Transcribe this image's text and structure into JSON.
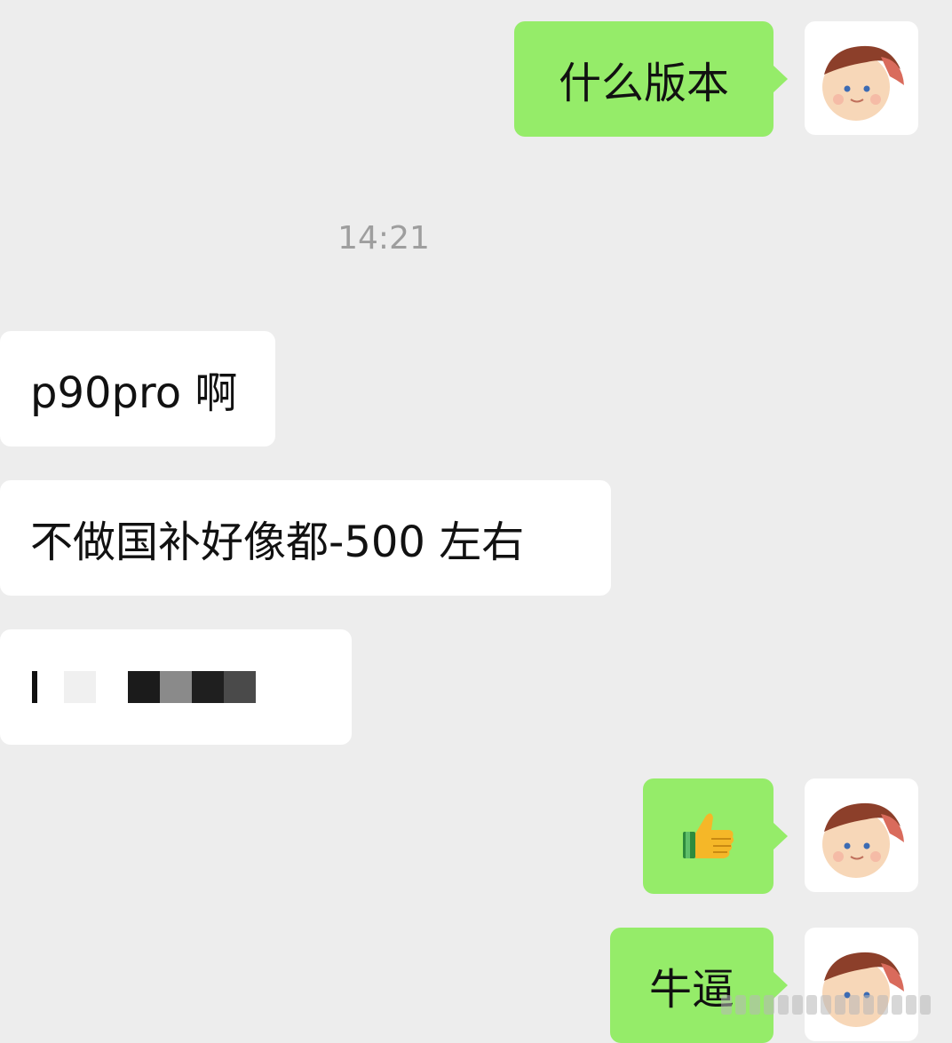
{
  "conversation": {
    "messages": [
      {
        "side": "out",
        "type": "text",
        "text": "什么版本"
      },
      {
        "side": "system",
        "type": "timestamp",
        "text": "14:21"
      },
      {
        "side": "in",
        "type": "text",
        "text": "p90pro 啊"
      },
      {
        "side": "in",
        "type": "text",
        "text": "不做国补好像都-500 左右"
      },
      {
        "side": "in",
        "type": "redacted",
        "text": ""
      },
      {
        "side": "out",
        "type": "emoji",
        "emoji": "thumbs-up-icon"
      },
      {
        "side": "out",
        "type": "text",
        "text": "牛逼"
      }
    ]
  },
  "colors": {
    "background": "#ededed",
    "outgoing_bubble": "#95ec69",
    "incoming_bubble": "#ffffff",
    "timestamp": "#9e9e9e"
  }
}
